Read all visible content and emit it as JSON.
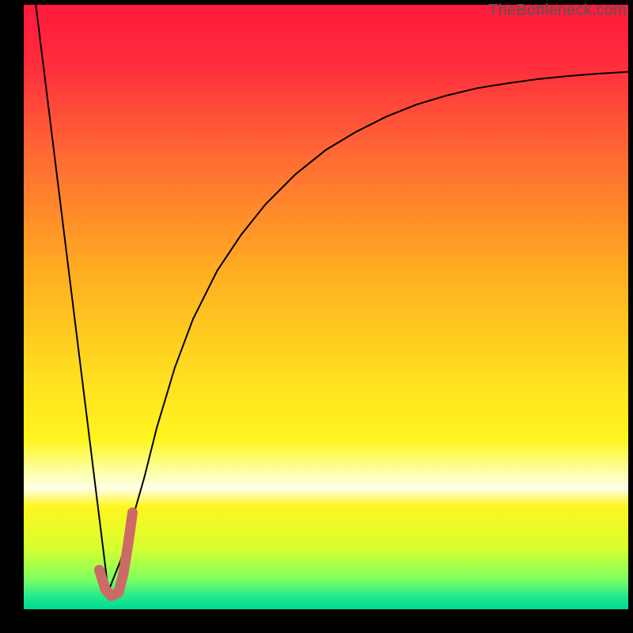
{
  "watermark": "TheBottleneck.com",
  "colors": {
    "bg": "#000000",
    "curve": "#000000",
    "curve_highlight": "#cc6a66",
    "gradient_stops": [
      {
        "offset": 0.0,
        "color": "#ff1a3c"
      },
      {
        "offset": 0.1,
        "color": "#ff2d3d"
      },
      {
        "offset": 0.25,
        "color": "#ff6a34"
      },
      {
        "offset": 0.45,
        "color": "#ffb020"
      },
      {
        "offset": 0.62,
        "color": "#ffe020"
      },
      {
        "offset": 0.72,
        "color": "#fff520"
      },
      {
        "offset": 0.77,
        "color": "#fcffa0"
      },
      {
        "offset": 0.8,
        "color": "#ffffe8"
      },
      {
        "offset": 0.83,
        "color": "#fff520"
      },
      {
        "offset": 0.9,
        "color": "#d6ff30"
      },
      {
        "offset": 0.95,
        "color": "#80ff60"
      },
      {
        "offset": 0.98,
        "color": "#20e890"
      },
      {
        "offset": 1.0,
        "color": "#00d890"
      }
    ]
  },
  "chart_data": {
    "type": "line",
    "title": "",
    "xlabel": "",
    "ylabel": "",
    "xlim": [
      0,
      100
    ],
    "ylim": [
      0,
      100
    ],
    "series": [
      {
        "name": "left-descent",
        "x": [
          2,
          14
        ],
        "y": [
          100,
          3
        ]
      },
      {
        "name": "main-curve",
        "x": [
          14,
          16,
          18,
          20,
          22,
          25,
          28,
          32,
          36,
          40,
          45,
          50,
          55,
          60,
          65,
          70,
          75,
          80,
          85,
          90,
          95,
          100
        ],
        "y": [
          3,
          8,
          15,
          22,
          30,
          40,
          48,
          56,
          62,
          67,
          72,
          76,
          79,
          81.5,
          83.5,
          85,
          86.2,
          87,
          87.7,
          88.2,
          88.6,
          88.9
        ]
      },
      {
        "name": "highlight-hook",
        "x": [
          12.5,
          13.5,
          14.5,
          15.7,
          16.5,
          17.3,
          18.0
        ],
        "y": [
          6.5,
          3.3,
          2.2,
          2.8,
          6.0,
          11.0,
          16.0
        ]
      }
    ]
  }
}
